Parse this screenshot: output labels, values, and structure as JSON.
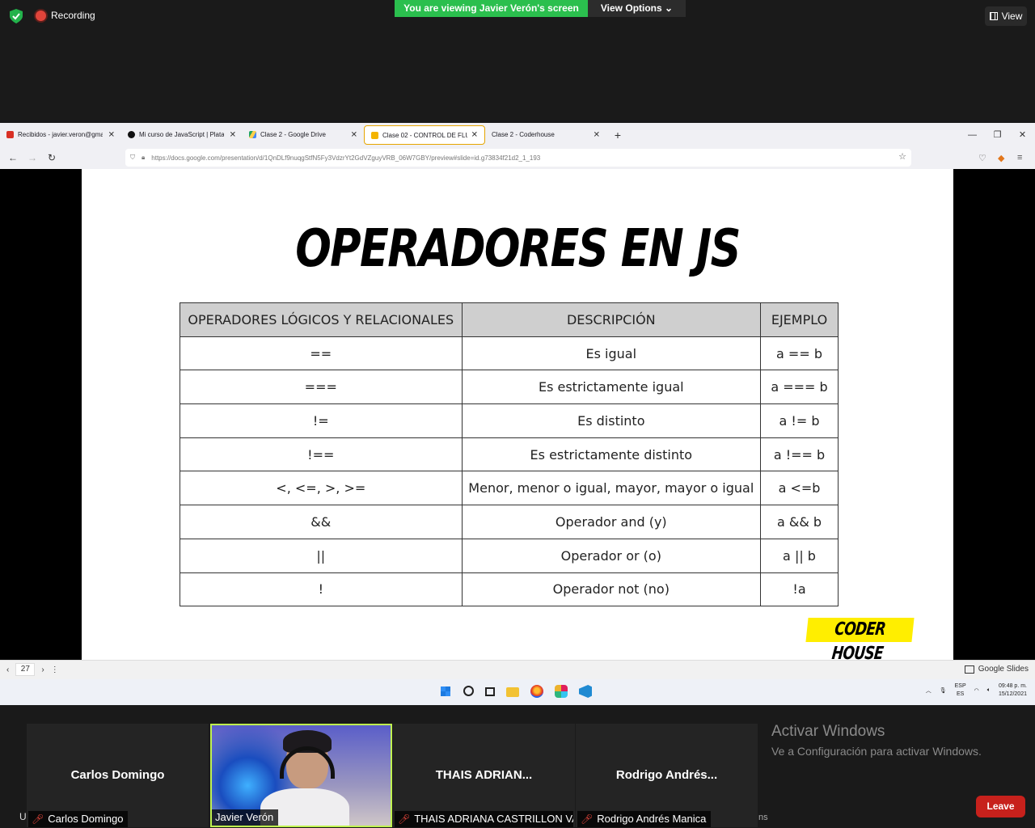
{
  "zoom": {
    "recording_label": "Recording",
    "viewing_banner": "You are viewing Javier Verón's screen",
    "view_options_label": "View Options",
    "view_button_label": "View",
    "leave_label": "Leave",
    "participants": [
      {
        "display_name": "Carlos Domingo",
        "tag": "Carlos Domingo",
        "muted": true,
        "video": false
      },
      {
        "display_name": "",
        "tag": "Javier Verón",
        "muted": false,
        "video": true
      },
      {
        "display_name": "THAIS ADRIAN...",
        "tag": "THAIS ADRIANA CASTRILLON VA...",
        "muted": true,
        "video": false
      },
      {
        "display_name": "Rodrigo Andrés...",
        "tag": "Rodrigo Andrés Manica",
        "muted": true,
        "video": false
      }
    ],
    "left_fragment": "U",
    "right_fragment": "ns"
  },
  "windows_watermark": {
    "line1": "Activar Windows",
    "line2": "Ve a Configuración para activar Windows."
  },
  "browser": {
    "tabs": [
      {
        "title": "Recibidos - javier.veron@gmail",
        "favicon": "gmail-icon",
        "color": "#d93025",
        "active": false
      },
      {
        "title": "Mi curso de JavaScript | Platafo",
        "favicon": "coderhouse-icon",
        "color": "#111111",
        "active": false
      },
      {
        "title": "Clase 2 - Google Drive",
        "favicon": "drive-icon",
        "color": "#1fa463",
        "active": false
      },
      {
        "title": "Clase 02 - CONTROL DE FLUJO",
        "favicon": "slides-icon",
        "color": "#f4b400",
        "active": true
      },
      {
        "title": "Clase 2 - Coderhouse",
        "favicon": "",
        "color": "",
        "active": false
      }
    ],
    "url": "https://docs.google.com/presentation/d/1QnDLf9nuqgStfN5Fy3VdzrYt2GdVZguyVRB_06W7GBY/preview#slide=id.g73834f21d2_1_193"
  },
  "slide": {
    "title": "OPERADORES EN JS",
    "headers": [
      "OPERADORES LÓGICOS Y RELACIONALES",
      "DESCRIPCIÓN",
      "EJEMPLO"
    ],
    "rows": [
      [
        "==",
        "Es igual",
        "a == b"
      ],
      [
        "===",
        "Es estrictamente igual",
        "a === b"
      ],
      [
        "!=",
        "Es distinto",
        "a != b"
      ],
      [
        "!==",
        "Es estrictamente distinto",
        "a !== b"
      ],
      [
        "<, <=, >, >=",
        "Menor, menor o igual, mayor, mayor o igual",
        "a <=b"
      ],
      [
        "&&",
        "Operador and (y)",
        "a && b"
      ],
      [
        "||",
        "Operador or (o)",
        "a || b"
      ],
      [
        "!",
        "Operador not (no)",
        "!a"
      ]
    ],
    "logo": "CODER HOUSE",
    "page_number": "27",
    "app_label": "Google Slides"
  },
  "taskbar": {
    "lang_top": "ESP",
    "lang_bottom": "ES",
    "time": "09:48 p. m.",
    "date": "15/12/2021"
  }
}
